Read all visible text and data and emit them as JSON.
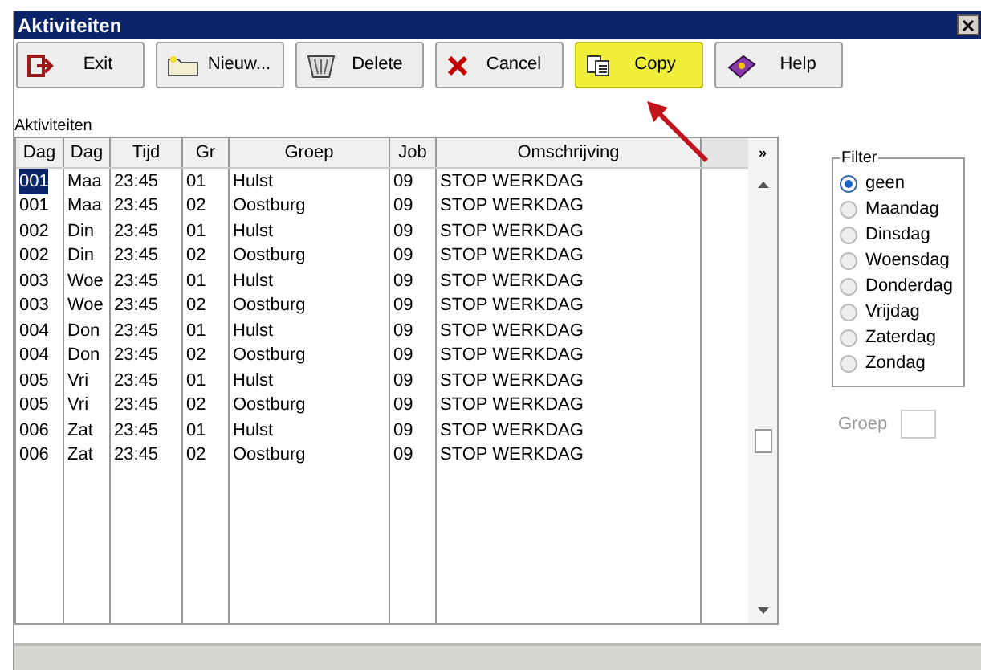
{
  "window": {
    "title": "Aktiviteiten"
  },
  "toolbar": [
    {
      "label": "Exit",
      "kind": "exit",
      "highlighted": false
    },
    {
      "label": "Nieuw...",
      "kind": "new",
      "highlighted": false
    },
    {
      "label": "Delete",
      "kind": "delete",
      "highlighted": false
    },
    {
      "label": "Cancel",
      "kind": "cancel",
      "highlighted": false
    },
    {
      "label": "Copy",
      "kind": "copy",
      "highlighted": true
    },
    {
      "label": "Help",
      "kind": "help",
      "highlighted": false
    }
  ],
  "table": {
    "caption": "Aktiviteiten",
    "columns": [
      "Dag",
      "Dag",
      "Tijd",
      "Gr",
      "Groep",
      "Job",
      "Omschrijving",
      "»"
    ],
    "rows": [
      {
        "selected": true,
        "cells": [
          "001",
          "Maa",
          "23:45",
          "01",
          "Hulst",
          "09",
          "STOP WERKDAG"
        ]
      },
      {
        "selected": false,
        "cells": [
          "001",
          "Maa",
          "23:45",
          "02",
          "Oostburg",
          "09",
          "STOP WERKDAG"
        ]
      },
      {
        "selected": false,
        "cells": [
          "002",
          "Din",
          "23:45",
          "01",
          "Hulst",
          "09",
          "STOP WERKDAG"
        ]
      },
      {
        "selected": false,
        "cells": [
          "002",
          "Din",
          "23:45",
          "02",
          "Oostburg",
          "09",
          "STOP WERKDAG"
        ]
      },
      {
        "selected": false,
        "cells": [
          "003",
          "Woe",
          "23:45",
          "01",
          "Hulst",
          "09",
          "STOP WERKDAG"
        ]
      },
      {
        "selected": false,
        "cells": [
          "003",
          "Woe",
          "23:45",
          "02",
          "Oostburg",
          "09",
          "STOP WERKDAG"
        ]
      },
      {
        "selected": false,
        "cells": [
          "004",
          "Don",
          "23:45",
          "01",
          "Hulst",
          "09",
          "STOP WERKDAG"
        ]
      },
      {
        "selected": false,
        "cells": [
          "004",
          "Don",
          "23:45",
          "02",
          "Oostburg",
          "09",
          "STOP WERKDAG"
        ]
      },
      {
        "selected": false,
        "cells": [
          "005",
          "Vri",
          "23:45",
          "01",
          "Hulst",
          "09",
          "STOP WERKDAG"
        ]
      },
      {
        "selected": false,
        "cells": [
          "005",
          "Vri",
          "23:45",
          "02",
          "Oostburg",
          "09",
          "STOP WERKDAG"
        ]
      },
      {
        "selected": false,
        "cells": [
          "006",
          "Zat",
          "23:45",
          "01",
          "Hulst",
          "09",
          "STOP WERKDAG"
        ]
      },
      {
        "selected": false,
        "cells": [
          "006",
          "Zat",
          "23:45",
          "02",
          "Oostburg",
          "09",
          "STOP WERKDAG"
        ]
      }
    ]
  },
  "filter": {
    "title": "Filter",
    "options": [
      {
        "label": "geen",
        "selected": true
      },
      {
        "label": "Maandag",
        "selected": false
      },
      {
        "label": "Dinsdag",
        "selected": false
      },
      {
        "label": "Woensdag",
        "selected": false
      },
      {
        "label": "Donderdag",
        "selected": false
      },
      {
        "label": "Vrijdag",
        "selected": false
      },
      {
        "label": "Zaterdag",
        "selected": false
      },
      {
        "label": "Zondag",
        "selected": false
      }
    ]
  },
  "groep_field": {
    "label": "Groep",
    "disabled": true
  }
}
